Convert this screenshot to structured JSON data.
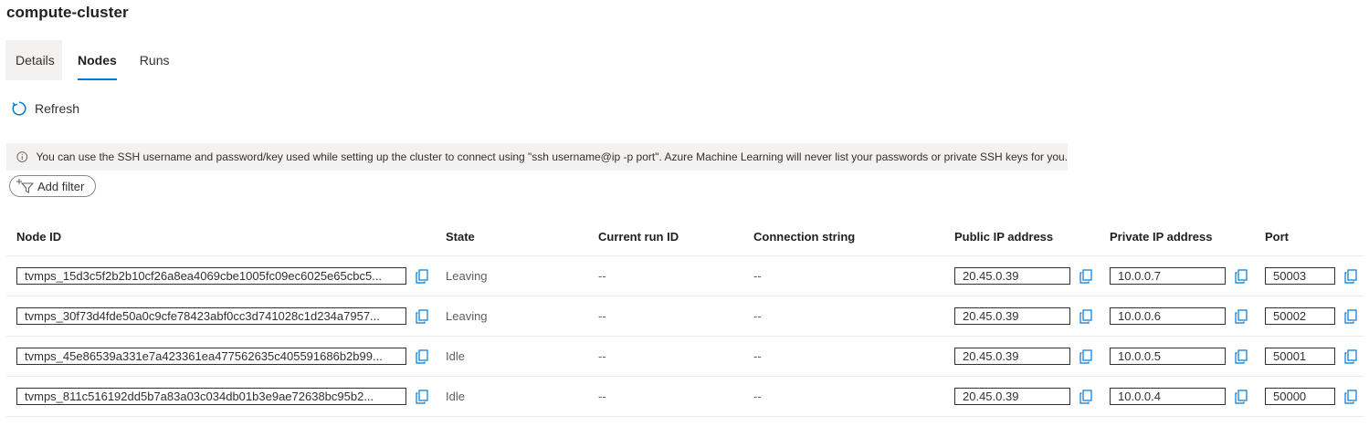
{
  "page": {
    "title": "compute-cluster"
  },
  "tabs": [
    {
      "label": "Details"
    },
    {
      "label": "Nodes"
    },
    {
      "label": "Runs"
    }
  ],
  "toolbar": {
    "refresh_label": "Refresh"
  },
  "info": {
    "icon": "info-icon",
    "text": "You can use the SSH username and password/key used while setting up the cluster to connect using \"ssh username@ip -p port\". Azure Machine Learning will never list your passwords or private SSH keys for you."
  },
  "filter": {
    "label": "Add filter"
  },
  "table": {
    "headers": {
      "node_id": "Node ID",
      "state": "State",
      "run_id": "Current run ID",
      "connection": "Connection string",
      "public_ip": "Public IP address",
      "private_ip": "Private IP address",
      "port": "Port"
    },
    "rows": [
      {
        "node_id": "tvmps_15d3c5f2b2b10cf26a8ea4069cbe1005fc09ec6025e65cbc5...",
        "state": "Leaving",
        "run_id": "--",
        "connection": "--",
        "public_ip": "20.45.0.39",
        "private_ip": "10.0.0.7",
        "port": "50003"
      },
      {
        "node_id": "tvmps_30f73d4fde50a0c9cfe78423abf0cc3d741028c1d234a7957...",
        "state": "Leaving",
        "run_id": "--",
        "connection": "--",
        "public_ip": "20.45.0.39",
        "private_ip": "10.0.0.6",
        "port": "50002"
      },
      {
        "node_id": "tvmps_45e86539a331e7a423361ea477562635c405591686b2b99...",
        "state": "Idle",
        "run_id": "--",
        "connection": "--",
        "public_ip": "20.45.0.39",
        "private_ip": "10.0.0.5",
        "port": "50001"
      },
      {
        "node_id": "tvmps_811c516192dd5b7a83a03c034db01b3e9ae72638bc95b2...",
        "state": "Idle",
        "run_id": "--",
        "connection": "--",
        "public_ip": "20.45.0.39",
        "private_ip": "10.0.0.4",
        "port": "50000"
      }
    ]
  },
  "colors": {
    "accent": "#0078d4",
    "info_bg": "#f3f2f1",
    "text": "#323130"
  }
}
